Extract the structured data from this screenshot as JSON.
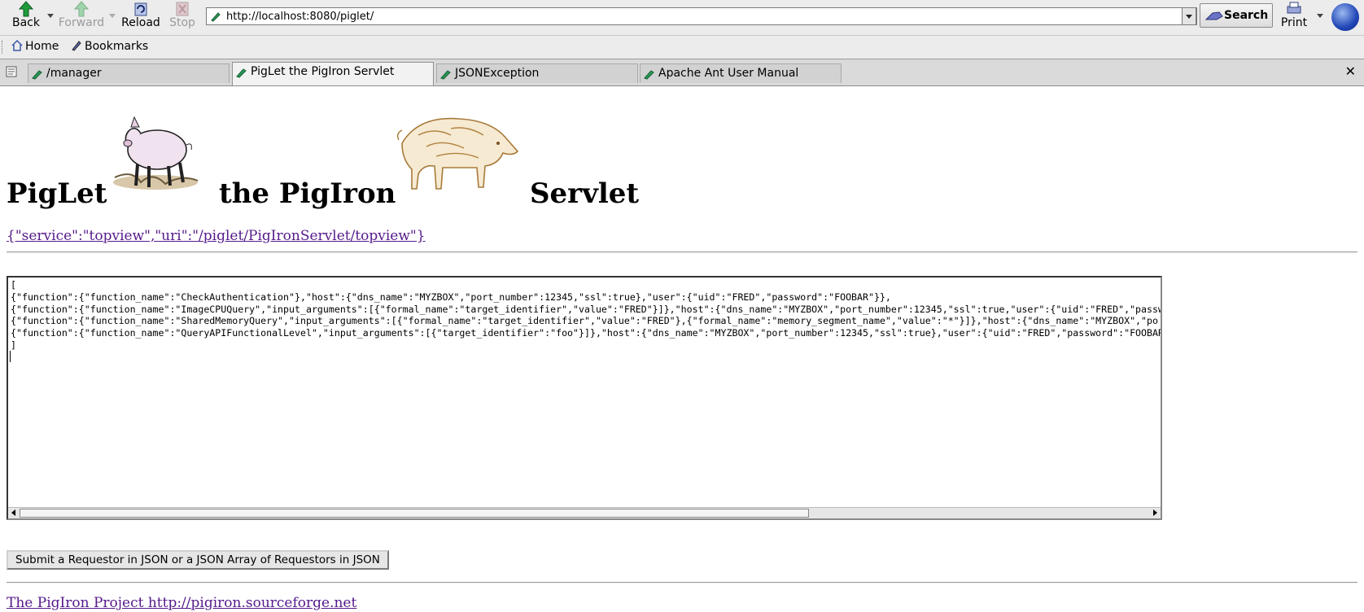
{
  "browser": {
    "toolbar": {
      "back_label": "Back",
      "forward_label": "Forward",
      "reload_label": "Reload",
      "stop_label": "Stop",
      "search_label": "Search",
      "print_label": "Print"
    },
    "url": "http://localhost:8080/piglet/",
    "bookmarks": {
      "home_label": "Home",
      "bookmarks_label": "Bookmarks"
    },
    "tabs": [
      {
        "label": "/manager",
        "active": false
      },
      {
        "label": "PigLet the PigIron Servlet",
        "active": true
      },
      {
        "label": "JSONException",
        "active": false
      },
      {
        "label": "Apache Ant User Manual",
        "active": false
      }
    ],
    "close_tab_glyph": "✕"
  },
  "page": {
    "heading_parts": [
      "PigLet",
      "the PigIron",
      "Servlet"
    ],
    "service_link": "{\"service\":\"topview\",\"uri\":\"/piglet/PigIronServlet/topview\"}",
    "textarea_lines": [
      "[",
      "{\"function\":{\"function_name\":\"CheckAuthentication\"},\"host\":{\"dns_name\":\"MYZBOX\",\"port_number\":12345,\"ssl\":true},\"user\":{\"uid\":\"FRED\",\"password\":\"FOOBAR\"}},",
      "{\"function\":{\"function_name\":\"ImageCPUQuery\",\"input_arguments\":[{\"formal_name\":\"target_identifier\",\"value\":\"FRED\"}]},\"host\":{\"dns_name\":\"MYZBOX\",\"port_number\":12345,\"ssl\":true,\"user\":{\"uid\":\"FRED\",\"passw",
      "{\"function\":{\"function_name\":\"SharedMemoryQuery\",\"input_arguments\":[{\"formal_name\":\"target_identifier\",\"value\":\"FRED\"},{\"formal_name\":\"memory_segment_name\",\"value\":\"*\"}]},\"host\":{\"dns_name\":\"MYZBOX\",\"po",
      "{\"function\":{\"function_name\":\"QueryAPIFunctionalLevel\",\"input_arguments\":[{\"target_identifier\":\"foo\"}]},\"host\":{\"dns_name\":\"MYZBOX\",\"port_number\":12345,\"ssl\":true},\"user\":{\"uid\":\"FRED\",\"password\":\"FOOBAR",
      "]"
    ],
    "submit_label": "Submit a Requestor in JSON or a JSON Array of Requestors in JSON",
    "footer_link": "The PigIron Project http://pigiron.sourceforge.net"
  },
  "icons": {
    "back": "green-left-arrow-icon",
    "forward": "green-right-arrow-icon",
    "reload": "reload-icon",
    "stop": "stop-icon",
    "search": "search-icon",
    "print": "printer-icon",
    "throbber": "throbber-icon"
  },
  "colors": {
    "visited_link": "#551a8b",
    "chrome_bg": "#ececec"
  }
}
